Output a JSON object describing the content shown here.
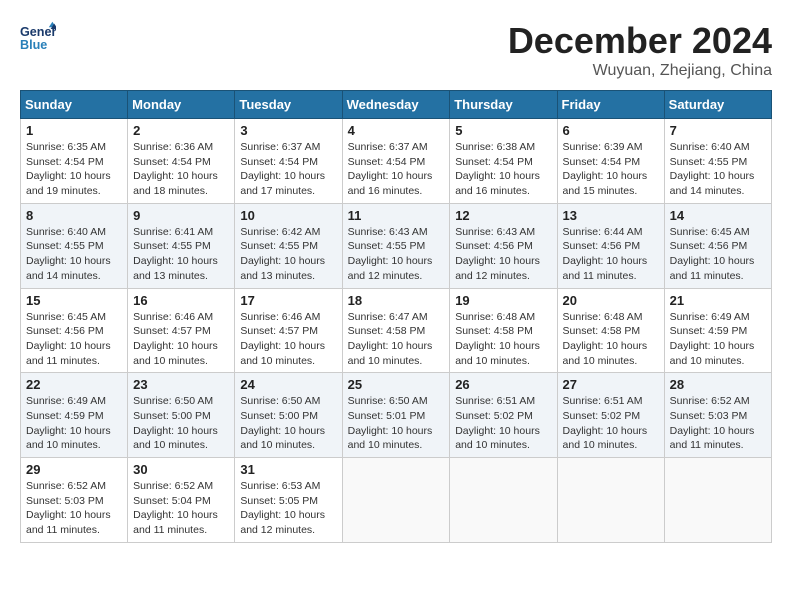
{
  "header": {
    "logo_line1": "General",
    "logo_line2": "Blue",
    "month_title": "December 2024",
    "location": "Wuyuan, Zhejiang, China"
  },
  "weekdays": [
    "Sunday",
    "Monday",
    "Tuesday",
    "Wednesday",
    "Thursday",
    "Friday",
    "Saturday"
  ],
  "weeks": [
    [
      {
        "day": "1",
        "info": "Sunrise: 6:35 AM\nSunset: 4:54 PM\nDaylight: 10 hours and 19 minutes."
      },
      {
        "day": "2",
        "info": "Sunrise: 6:36 AM\nSunset: 4:54 PM\nDaylight: 10 hours and 18 minutes."
      },
      {
        "day": "3",
        "info": "Sunrise: 6:37 AM\nSunset: 4:54 PM\nDaylight: 10 hours and 17 minutes."
      },
      {
        "day": "4",
        "info": "Sunrise: 6:37 AM\nSunset: 4:54 PM\nDaylight: 10 hours and 16 minutes."
      },
      {
        "day": "5",
        "info": "Sunrise: 6:38 AM\nSunset: 4:54 PM\nDaylight: 10 hours and 16 minutes."
      },
      {
        "day": "6",
        "info": "Sunrise: 6:39 AM\nSunset: 4:54 PM\nDaylight: 10 hours and 15 minutes."
      },
      {
        "day": "7",
        "info": "Sunrise: 6:40 AM\nSunset: 4:55 PM\nDaylight: 10 hours and 14 minutes."
      }
    ],
    [
      {
        "day": "8",
        "info": "Sunrise: 6:40 AM\nSunset: 4:55 PM\nDaylight: 10 hours and 14 minutes."
      },
      {
        "day": "9",
        "info": "Sunrise: 6:41 AM\nSunset: 4:55 PM\nDaylight: 10 hours and 13 minutes."
      },
      {
        "day": "10",
        "info": "Sunrise: 6:42 AM\nSunset: 4:55 PM\nDaylight: 10 hours and 13 minutes."
      },
      {
        "day": "11",
        "info": "Sunrise: 6:43 AM\nSunset: 4:55 PM\nDaylight: 10 hours and 12 minutes."
      },
      {
        "day": "12",
        "info": "Sunrise: 6:43 AM\nSunset: 4:56 PM\nDaylight: 10 hours and 12 minutes."
      },
      {
        "day": "13",
        "info": "Sunrise: 6:44 AM\nSunset: 4:56 PM\nDaylight: 10 hours and 11 minutes."
      },
      {
        "day": "14",
        "info": "Sunrise: 6:45 AM\nSunset: 4:56 PM\nDaylight: 10 hours and 11 minutes."
      }
    ],
    [
      {
        "day": "15",
        "info": "Sunrise: 6:45 AM\nSunset: 4:56 PM\nDaylight: 10 hours and 11 minutes."
      },
      {
        "day": "16",
        "info": "Sunrise: 6:46 AM\nSunset: 4:57 PM\nDaylight: 10 hours and 10 minutes."
      },
      {
        "day": "17",
        "info": "Sunrise: 6:46 AM\nSunset: 4:57 PM\nDaylight: 10 hours and 10 minutes."
      },
      {
        "day": "18",
        "info": "Sunrise: 6:47 AM\nSunset: 4:58 PM\nDaylight: 10 hours and 10 minutes."
      },
      {
        "day": "19",
        "info": "Sunrise: 6:48 AM\nSunset: 4:58 PM\nDaylight: 10 hours and 10 minutes."
      },
      {
        "day": "20",
        "info": "Sunrise: 6:48 AM\nSunset: 4:58 PM\nDaylight: 10 hours and 10 minutes."
      },
      {
        "day": "21",
        "info": "Sunrise: 6:49 AM\nSunset: 4:59 PM\nDaylight: 10 hours and 10 minutes."
      }
    ],
    [
      {
        "day": "22",
        "info": "Sunrise: 6:49 AM\nSunset: 4:59 PM\nDaylight: 10 hours and 10 minutes."
      },
      {
        "day": "23",
        "info": "Sunrise: 6:50 AM\nSunset: 5:00 PM\nDaylight: 10 hours and 10 minutes."
      },
      {
        "day": "24",
        "info": "Sunrise: 6:50 AM\nSunset: 5:00 PM\nDaylight: 10 hours and 10 minutes."
      },
      {
        "day": "25",
        "info": "Sunrise: 6:50 AM\nSunset: 5:01 PM\nDaylight: 10 hours and 10 minutes."
      },
      {
        "day": "26",
        "info": "Sunrise: 6:51 AM\nSunset: 5:02 PM\nDaylight: 10 hours and 10 minutes."
      },
      {
        "day": "27",
        "info": "Sunrise: 6:51 AM\nSunset: 5:02 PM\nDaylight: 10 hours and 10 minutes."
      },
      {
        "day": "28",
        "info": "Sunrise: 6:52 AM\nSunset: 5:03 PM\nDaylight: 10 hours and 11 minutes."
      }
    ],
    [
      {
        "day": "29",
        "info": "Sunrise: 6:52 AM\nSunset: 5:03 PM\nDaylight: 10 hours and 11 minutes."
      },
      {
        "day": "30",
        "info": "Sunrise: 6:52 AM\nSunset: 5:04 PM\nDaylight: 10 hours and 11 minutes."
      },
      {
        "day": "31",
        "info": "Sunrise: 6:53 AM\nSunset: 5:05 PM\nDaylight: 10 hours and 12 minutes."
      },
      null,
      null,
      null,
      null
    ]
  ]
}
